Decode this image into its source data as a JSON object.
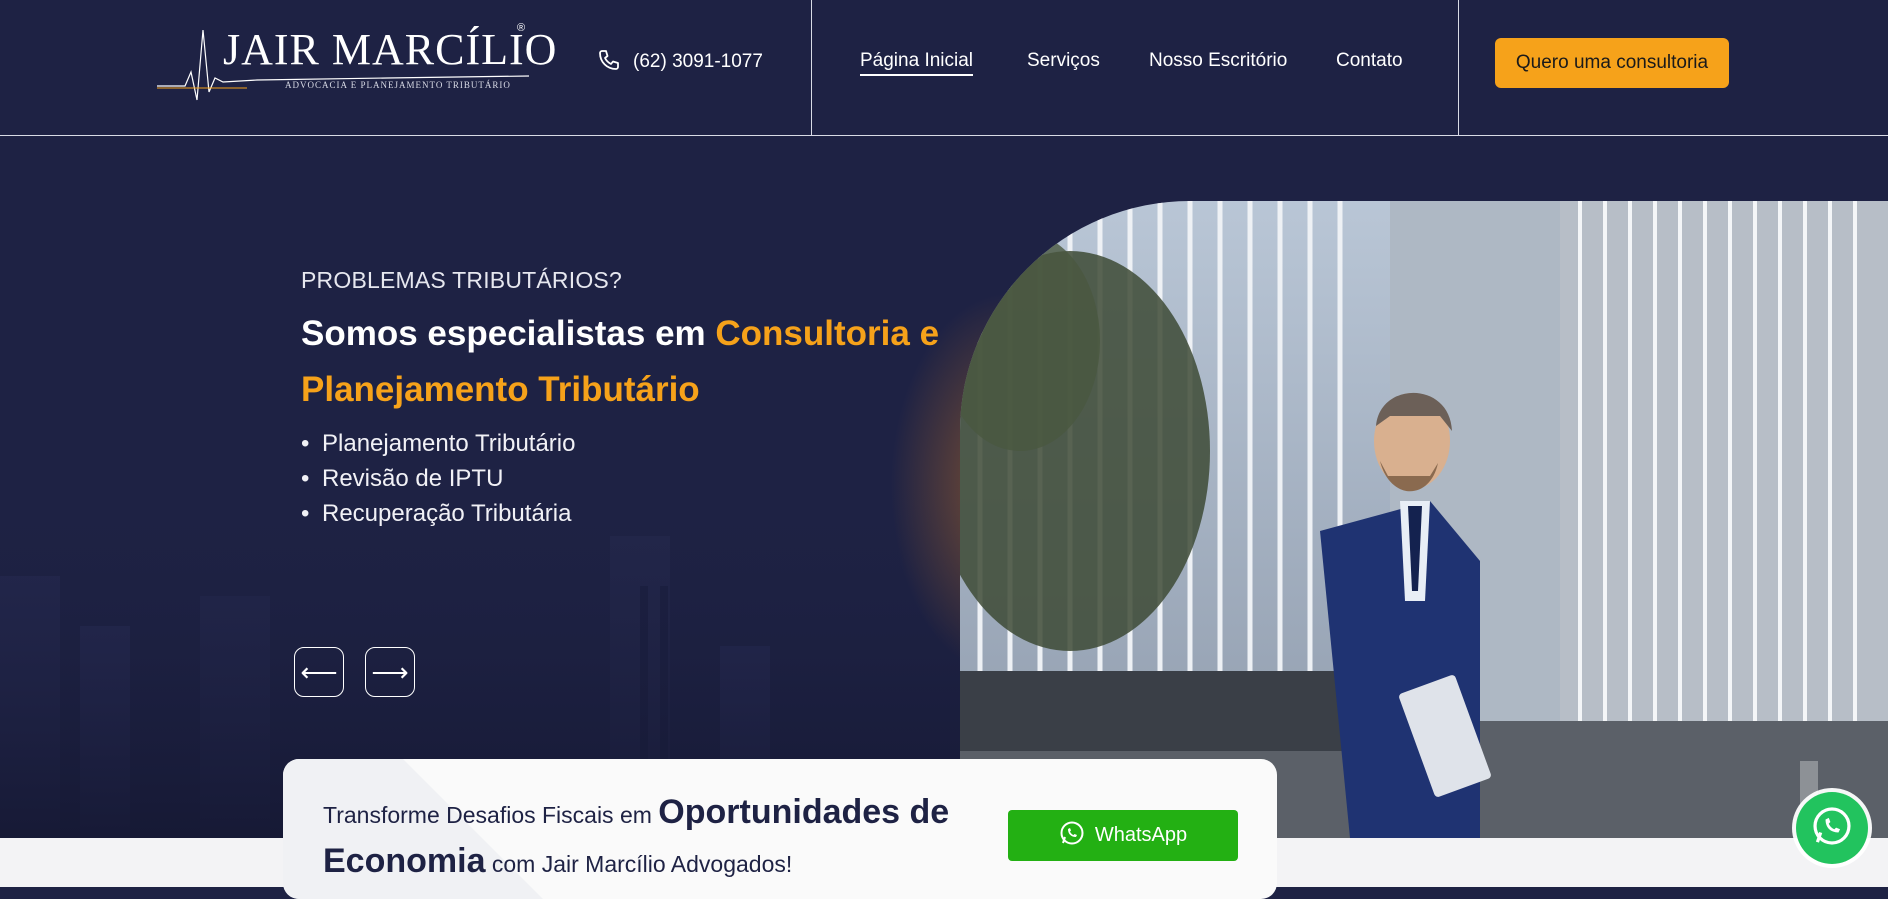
{
  "header": {
    "logo": {
      "name": "JAIR MARCÍLIO",
      "registered": "®",
      "subtitle": "ADVOCACIA E PLANEJAMENTO TRIBUTÁRIO"
    },
    "phone": {
      "icon": "phone-icon",
      "number": "(62) 3091-1077"
    },
    "nav": [
      {
        "label": "Página Inicial",
        "active": true
      },
      {
        "label": "Serviços",
        "active": false
      },
      {
        "label": "Nosso Escritório",
        "active": false
      },
      {
        "label": "Contato",
        "active": false
      }
    ],
    "cta_label": "Quero uma consultoria"
  },
  "hero": {
    "eyebrow": "PROBLEMAS TRIBUTÁRIOS?",
    "headline_prefix": "Somos especialistas em",
    "headline_highlight": "Consultoria e Planejamento Tributário",
    "bullets": [
      "Planejamento Tributário",
      "Revisão de IPTU",
      "Recuperação Tributária"
    ],
    "prev_icon": "arrow-left-icon",
    "next_icon": "arrow-right-icon"
  },
  "card": {
    "text_prefix": "Transforme Desafios Fiscais em",
    "text_big": "Oportunidades de Economia",
    "text_suffix": "com Jair Marcílio Advogados!",
    "whatsapp_label": "WhatsApp"
  },
  "colors": {
    "navy": "#1e2244",
    "accent": "#f6a21a",
    "whatsapp": "#23b013",
    "whatsapp_float": "#22c35e"
  }
}
